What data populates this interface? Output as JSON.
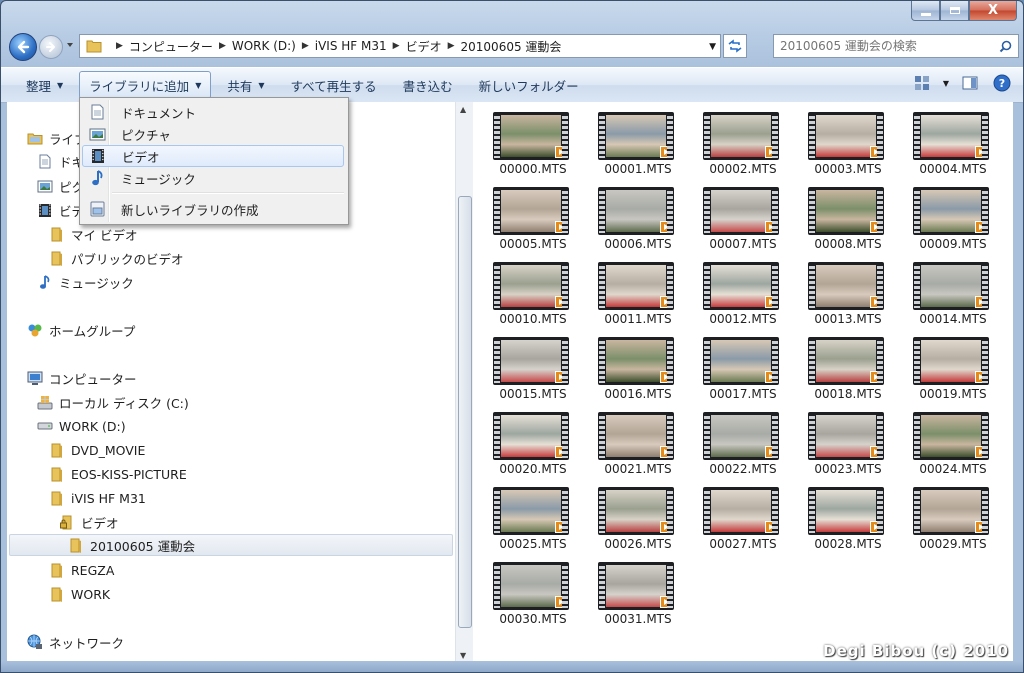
{
  "window": {
    "minimize_label": "",
    "maximize_label": "",
    "close_label": "X"
  },
  "address": {
    "crumbs": [
      "コンピューター",
      "WORK (D:)",
      "iVIS HF M31",
      "ビデオ",
      "20100605 運動会"
    ]
  },
  "search": {
    "placeholder": "20100605 運動会の検索"
  },
  "toolbar": {
    "organize": "整理",
    "add_to_library": "ライブラリに追加",
    "share": "共有",
    "play_all": "すべて再生する",
    "burn": "書き込む",
    "new_folder": "新しいフォルダー"
  },
  "menu": {
    "items": [
      "ドキュメント",
      "ピクチャ",
      "ビデオ",
      "ミュージック"
    ],
    "create_new": "新しいライブラリの作成",
    "highlighted": "ビデオ"
  },
  "nav": {
    "libraries_partial": "ライブ",
    "docs_partial": "ドキ",
    "pics_partial": "ピク",
    "video_partial": "ビデ",
    "my_videos": "マイ ビデオ",
    "public_videos": "パブリックのビデオ",
    "music": "ミュージック",
    "homegroup": "ホームグループ",
    "computer": "コンピューター",
    "local_disk": "ローカル ディスク (C:)",
    "work_drive": "WORK (D:)",
    "dvd_movie": "DVD_MOVIE",
    "eos": "EOS-KISS-PICTURE",
    "ivis": "iVIS HF M31",
    "video": "ビデオ",
    "selected_folder": "20100605 運動会",
    "regza": "REGZA",
    "work": "WORK",
    "network": "ネットワーク"
  },
  "files": [
    "00000.MTS",
    "00001.MTS",
    "00002.MTS",
    "00003.MTS",
    "00004.MTS",
    "00005.MTS",
    "00006.MTS",
    "00007.MTS",
    "00008.MTS",
    "00009.MTS",
    "00010.MTS",
    "00011.MTS",
    "00012.MTS",
    "00013.MTS",
    "00014.MTS",
    "00015.MTS",
    "00016.MTS",
    "00017.MTS",
    "00018.MTS",
    "00019.MTS",
    "00020.MTS",
    "00021.MTS",
    "00022.MTS",
    "00023.MTS",
    "00024.MTS",
    "00025.MTS",
    "00026.MTS",
    "00027.MTS",
    "00028.MTS",
    "00029.MTS",
    "00030.MTS",
    "00031.MTS"
  ],
  "watermark": "Degi Bibou (c) 2010",
  "colors": {
    "accent": "#2e6fc4",
    "video_badge": "#e58b1a",
    "folder": "#e8c25a"
  }
}
